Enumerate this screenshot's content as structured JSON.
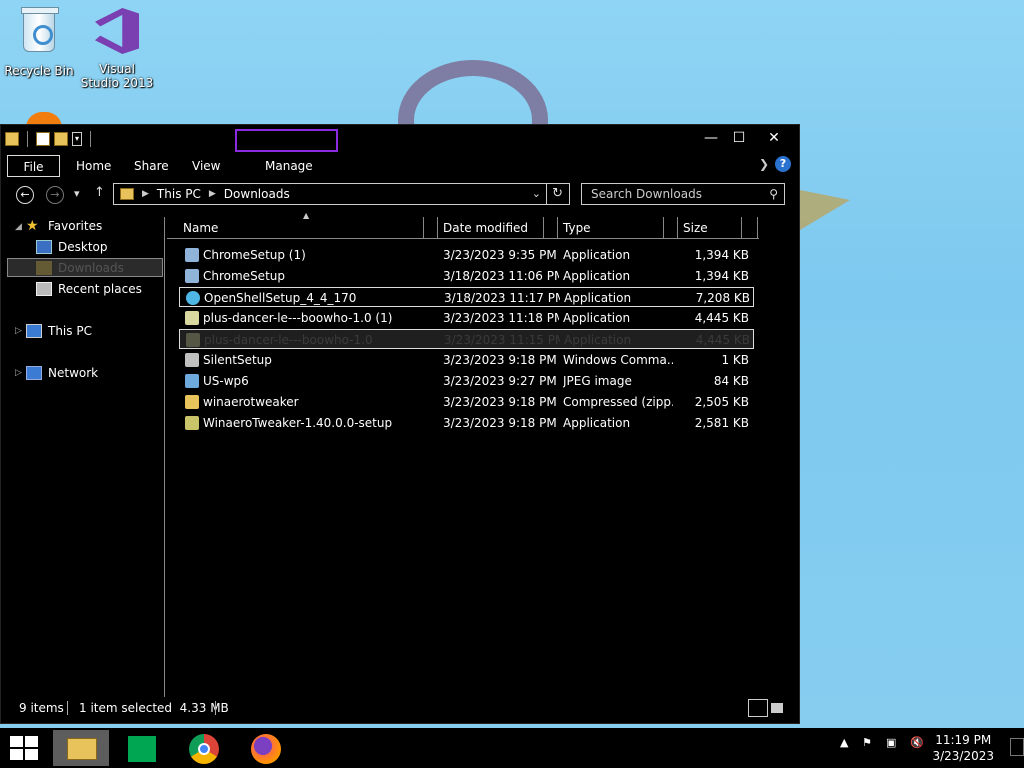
{
  "desktop": {
    "icons": [
      {
        "label": "Recycle Bin"
      },
      {
        "label": "Visual Studio 2013"
      }
    ]
  },
  "window": {
    "ribbon_tabs": [
      "File",
      "Home",
      "Share",
      "View",
      "Manage"
    ],
    "help_label": "?",
    "address": {
      "crumbs": [
        "This PC",
        "Downloads"
      ]
    },
    "search": {
      "placeholder": "Search Downloads"
    },
    "nav": {
      "favorites": "Favorites",
      "desktop": "Desktop",
      "downloads": "Downloads",
      "recent": "Recent places",
      "this_pc": "This PC",
      "network": "Network"
    },
    "columns": [
      "Name",
      "Date modified",
      "Type",
      "Size"
    ],
    "files": [
      {
        "name": "ChromeSetup (1)",
        "date": "3/23/2023 9:35 PM",
        "type": "Application",
        "size": "1,394 KB",
        "icon": "installer-icon"
      },
      {
        "name": "ChromeSetup",
        "date": "3/18/2023 11:06 PM",
        "type": "Application",
        "size": "1,394 KB",
        "icon": "installer-icon"
      },
      {
        "name": "OpenShellSetup_4_4_170",
        "date": "3/18/2023 11:17 PM",
        "type": "Application",
        "size": "7,208 KB",
        "icon": "shell-icon"
      },
      {
        "name": "plus-dancer-le---boowho-1.0 (1)",
        "date": "3/23/2023 11:18 PM",
        "type": "Application",
        "size": "4,445 KB",
        "icon": "app-icon"
      },
      {
        "name": "plus-dancer-le---boowho-1.0",
        "date": "3/23/2023 11:15 PM",
        "type": "Application",
        "size": "4,445 KB",
        "icon": "app-icon"
      },
      {
        "name": "SilentSetup",
        "date": "3/23/2023 9:18 PM",
        "type": "Windows Comma...",
        "size": "1 KB",
        "icon": "cmd-icon"
      },
      {
        "name": "US-wp6",
        "date": "3/23/2023 9:27 PM",
        "type": "JPEG image",
        "size": "84 KB",
        "icon": "image-icon"
      },
      {
        "name": "winaerotweaker",
        "date": "3/23/2023 9:18 PM",
        "type": "Compressed (zipp...",
        "size": "2,505 KB",
        "icon": "zip-icon"
      },
      {
        "name": "WinaeroTweaker-1.40.0.0-setup",
        "date": "3/23/2023 9:18 PM",
        "type": "Application",
        "size": "2,581 KB",
        "icon": "setup-icon"
      }
    ],
    "status": {
      "count": "9 items",
      "selection": "1 item selected  4.33 MB"
    }
  },
  "taskbar": {
    "clock_time": "11:19 PM",
    "clock_date": "3/23/2023"
  }
}
